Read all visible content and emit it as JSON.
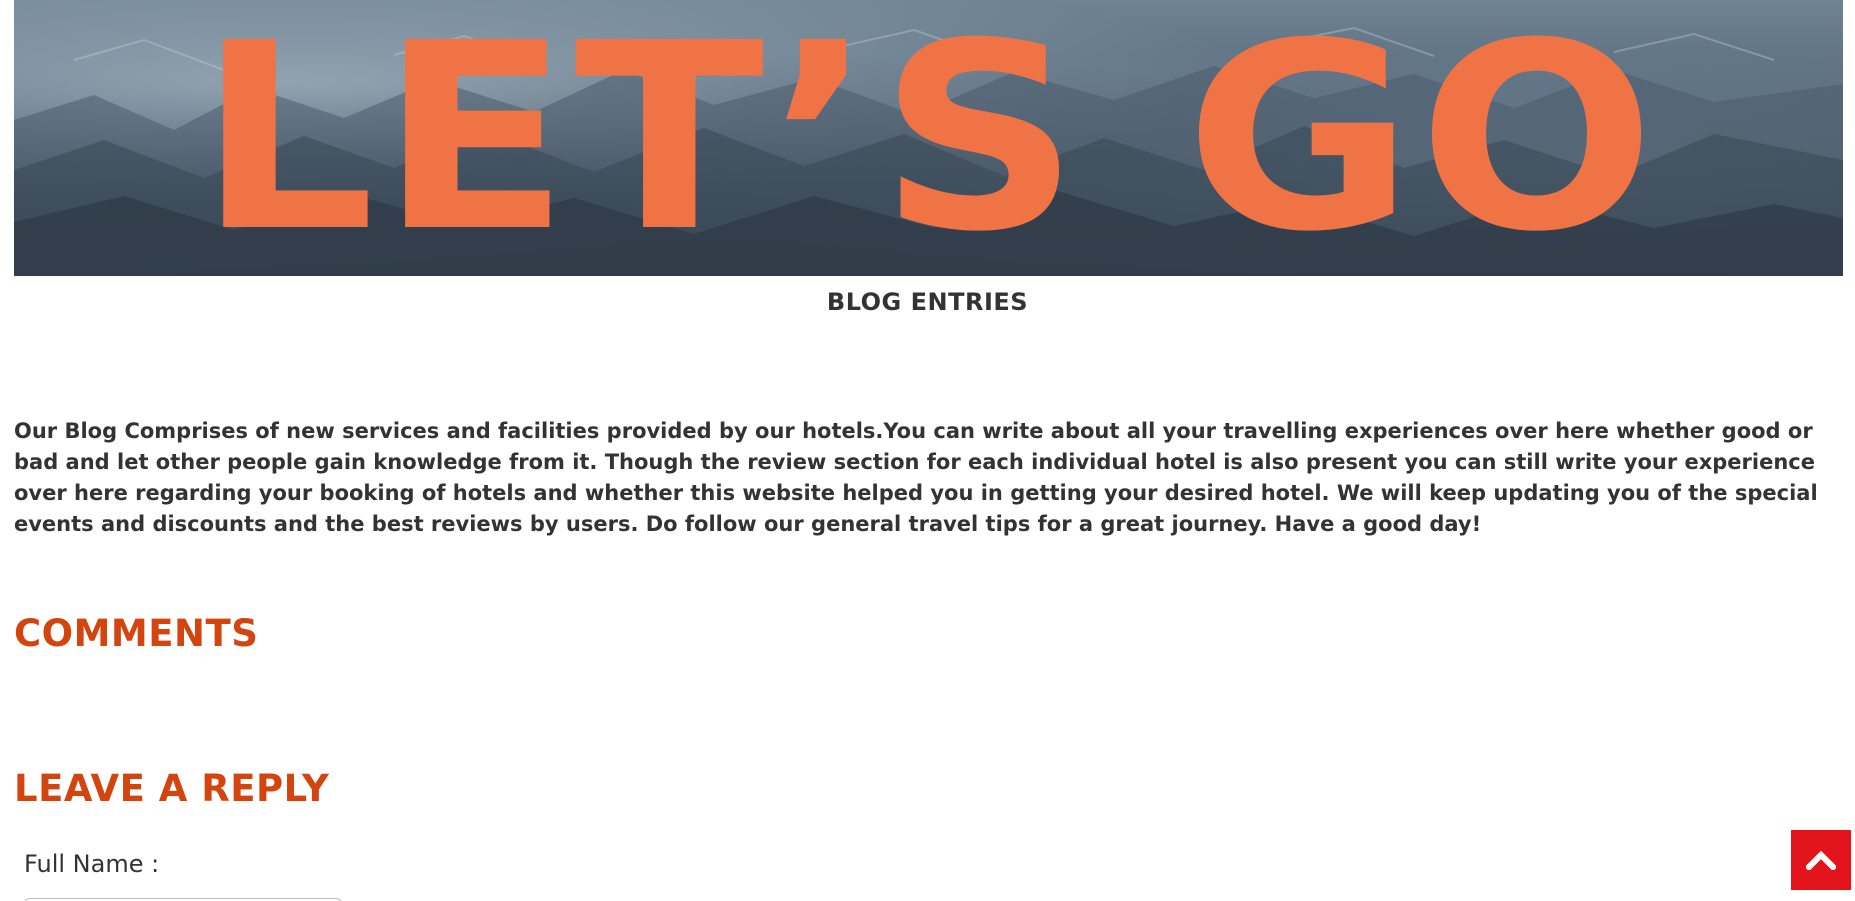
{
  "hero": {
    "title": "LET’S GO"
  },
  "blog": {
    "heading": "BLOG ENTRIES",
    "intro": "Our Blog Comprises of new services and facilities provided by our hotels.You can write about all your travelling experiences over here whether good or bad and let other people gain knowledge from it. Though the review section for each individual hotel is also present you can still write your experience over here regarding your booking of hotels and whether this website helped you in getting your desired hotel. We will keep updating you of the special events and discounts and the best reviews by users. Do follow our general travel tips for a great journey. Have a good day!"
  },
  "comments": {
    "heading": "COMMENTS"
  },
  "reply": {
    "heading": "LEAVE A REPLY",
    "full_name_label": "Full Name :",
    "full_name_value": ""
  },
  "scroll_top": {
    "icon": "chevron-up-icon"
  },
  "colors": {
    "hero_text": "#f07346",
    "section_heading": "#d3440e",
    "scroll_button": "#e4141c",
    "body_text": "#333333"
  }
}
